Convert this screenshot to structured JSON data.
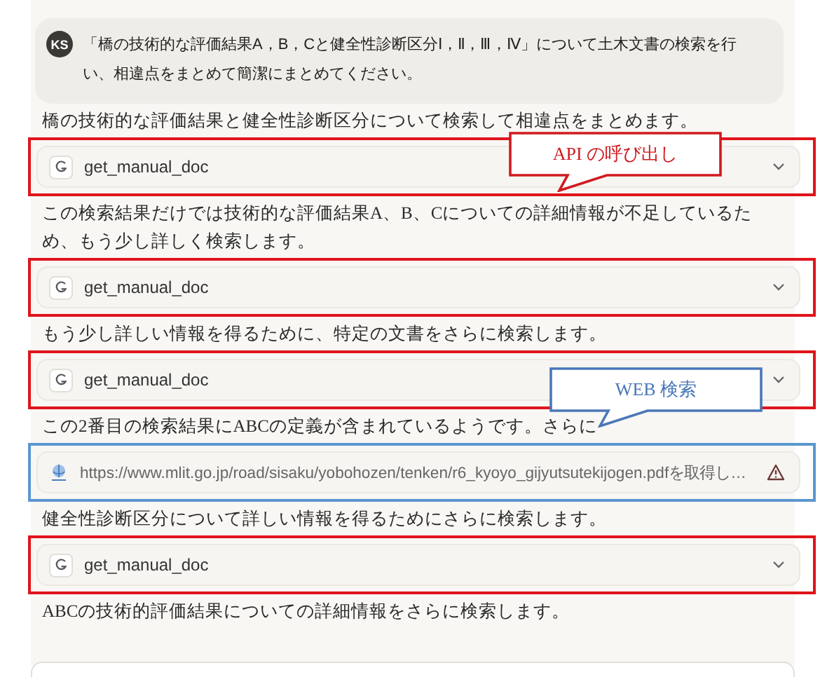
{
  "user_message": {
    "avatar": "KS",
    "text": "「橋の技術的な評価結果A，B，Cと健全性診断区分Ⅰ，Ⅱ，Ⅲ，Ⅳ」について土木文書の検索を行い、相違点をまとめて簡潔にまとめてください。"
  },
  "items": [
    {
      "kind": "text",
      "text": "橋の技術的な評価結果と健全性診断区分について検索して相違点をまとめます。"
    },
    {
      "kind": "tool",
      "name": "get_manual_doc",
      "color": "#e0141b"
    },
    {
      "kind": "text",
      "text": "この検索結果だけでは技術的な評価結果A、B、Cについての詳細情報が不足しているため、もう少し詳しく検索します。"
    },
    {
      "kind": "tool",
      "name": "get_manual_doc",
      "color": "#e0141b"
    },
    {
      "kind": "text",
      "text": "もう少し詳しい情報を得るために、特定の文書をさらに検索します。"
    },
    {
      "kind": "tool",
      "name": "get_manual_doc",
      "color": "#e0141b"
    },
    {
      "kind": "text",
      "text": "この2番目の検索結果にABCの定義が含まれているようです。さらに"
    },
    {
      "kind": "fetch",
      "url": "https://www.mlit.go.jp/road/sisaku/yobohozen/tenken/r6_kyoyo_gijyutsutekijogen.pdfを取得し…",
      "color": "#5b97cf"
    },
    {
      "kind": "text",
      "text": "健全性診断区分について詳しい情報を得るためにさらに検索します。"
    },
    {
      "kind": "tool",
      "name": "get_manual_doc",
      "color": "#e0141b"
    },
    {
      "kind": "text",
      "text": "ABCの技術的評価結果についての詳細情報をさらに検索します。"
    }
  ],
  "callouts": [
    {
      "text": "API の呼び出し",
      "color": "#d01a20"
    },
    {
      "text": "WEB 検索",
      "color": "#4a78b8"
    }
  ]
}
